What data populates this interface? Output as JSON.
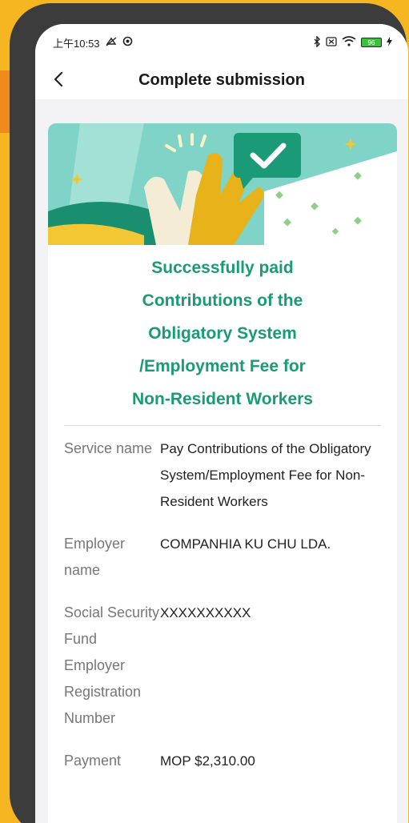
{
  "status_bar": {
    "time": "上午10:53",
    "battery": "96"
  },
  "header": {
    "title": "Complete submission"
  },
  "success": {
    "message_lines": [
      "Successfully paid",
      "Contributions of the",
      "Obligatory System",
      "/Employment Fee for",
      "Non-Resident Workers"
    ]
  },
  "details": [
    {
      "label": "Service name",
      "value": "Pay Contributions of the Obligatory System/Employment Fee for Non-Resident Workers"
    },
    {
      "label": "Employer name",
      "value": "COMPANHIA KU CHU LDA."
    },
    {
      "label": "Social Security Fund Employer Registration Number",
      "value": "XXXXXXXXXX"
    },
    {
      "label": "Payment",
      "value": "MOP $2,310.00"
    }
  ],
  "colors": {
    "accent_green": "#1b9a76",
    "background_yellow": "#f5b621",
    "banner_teal": "#7fd3c7"
  }
}
